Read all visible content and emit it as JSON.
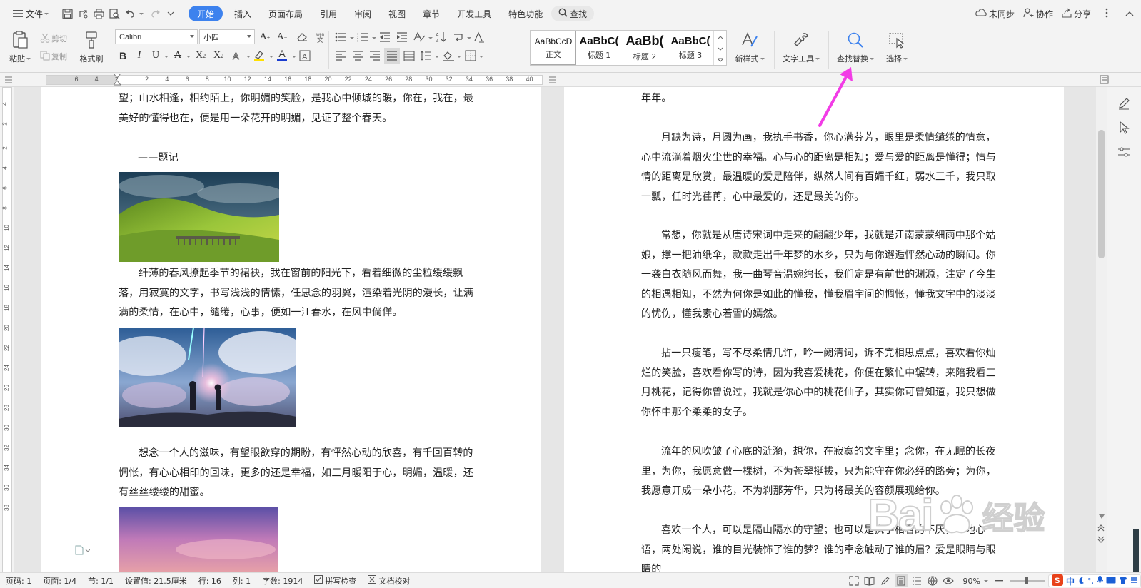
{
  "menubar": {
    "file_label": "文件",
    "tabs": [
      {
        "label": "开始",
        "active": true
      },
      {
        "label": "插入"
      },
      {
        "label": "页面布局"
      },
      {
        "label": "引用"
      },
      {
        "label": "审阅"
      },
      {
        "label": "视图"
      },
      {
        "label": "章节"
      },
      {
        "label": "开发工具"
      },
      {
        "label": "特色功能"
      }
    ],
    "search_label": "查找",
    "sync_label": "未同步",
    "collab_label": "协作",
    "share_label": "分享"
  },
  "ribbon": {
    "paste_label": "粘贴",
    "cut_label": "剪切",
    "copy_label": "复制",
    "format_painter_label": "格式刷",
    "font_name": "Calibri",
    "font_size": "小四",
    "styles": [
      {
        "sample": "AaBbCcD",
        "label": "正文"
      },
      {
        "sample": "AaBbC(",
        "label": "标题 1"
      },
      {
        "sample": "AaBb(",
        "label": "标题 2"
      },
      {
        "sample": "AaBbC(",
        "label": "标题 3"
      }
    ],
    "new_style_label": "新样式",
    "text_tools_label": "文字工具",
    "find_replace_label": "查找替换",
    "select_label": "选择"
  },
  "ruler": {
    "numbers": [
      "6",
      "4",
      "2",
      "2",
      "4",
      "6",
      "8",
      "10",
      "12",
      "14",
      "16",
      "18",
      "20",
      "22",
      "24",
      "26",
      "28",
      "30",
      "32",
      "34",
      "36",
      "38",
      "40"
    ]
  },
  "vruler": {
    "numbers": [
      "4",
      "2",
      "2",
      "4",
      "6",
      "8",
      "10",
      "12",
      "14",
      "16",
      "18",
      "20",
      "22",
      "24",
      "26",
      "28",
      "30",
      "32",
      "34",
      "36",
      "38"
    ]
  },
  "doc": {
    "left": {
      "p1": "望；山水相逢，相约陌上，你明媚的笑脸，是我心中倾城的暖，你在，我在，最美好的懂得也在，便是用一朵花开的明媚，见证了整个春天。",
      "signature": "——题记",
      "p2": "纤薄的春风撩起季节的裙袂，我在窗前的阳光下，看着细微的尘粒缓缓飘落，用寂寞的文字，书写浅浅的情愫，任思念的羽翼，渲染着光阴的漫长，让满满的柔情，在心中，缱绻，心事，便如一江春水，在风中倘佯。",
      "p3": "想念一个人的滋味，有望眼欲穿的期盼，有怦然心动的欣喜，有千回百转的惆怅，有心心相印的回味，更多的还是幸福，如三月暖阳于心，明媚，温暖，还有丝丝缕缕的甜蜜。"
    },
    "right": {
      "p0": "年年。",
      "p1": "月缺为诗，月圆为画，我执手书香，你心满芬芳，眼里是柔情缱绻的情意，心中流淌着烟火尘世的幸福。心与心的距离是相知；爱与爱的距离是懂得；情与情的距离是欣赏，最温暖的爱是陪伴，纵然人间有百媚千红，弱水三千，我只取一瓢，任时光荏苒，心中最爱的，还是最美的你。",
      "p2": "常想，你就是从唐诗宋词中走来的翩翩少年，我就是江南蒙蒙细雨中那个姑娘，撑一把油纸伞，款款走出千年梦的水乡，只为与你邂逅怦然心动的瞬间。你一袭白衣随风而舞，我一曲琴音温婉绵长，我们定是有前世的渊源，注定了今生的相遇相知，不然为何你是如此的懂我，懂我眉宇间的惆怅，懂我文字中的淡淡的忧伤，懂我素心若雪的嫣然。",
      "p3": "拈一只瘦笔，写不尽柔情几许，吟一阙清词，诉不完相思点点，喜欢看你灿烂的笑脸，喜欢看你写的诗，因为我喜爱桃花，你便在繁忙中辗转，来陪我看三月桃花，记得你曾说过，我就是你心中的桃花仙子，其实你可曾知道，我只想做你怀中那个柔柔的女子。",
      "p4": "流年的风吹皱了心底的涟漪，想你，在寂寞的文字里；念你，在无眠的长夜里，为你，我愿意做一棵树，不为苍翠挺拔，只为能守在你必经的路旁；为你，我愿意开成一朵小花，不为刹那芳华，只为将最美的容颜展现给你。",
      "p5": "喜欢一个人，可以是隔山隔水的守望；也可以是执手相看的不厌，一地心语，两处闲说，谁的目光装饰了谁的梦？谁的牵念触动了谁的眉？爱是眼睛与眼睛的"
    }
  },
  "statusbar": {
    "page_code": "页码: 1",
    "page": "页面: 1/4",
    "section": "节: 1/1",
    "setting": "设置值: 21.5厘米",
    "row": "行: 16",
    "col": "列: 1",
    "words": "字数: 1914",
    "spell_check": "拼写检查",
    "doc_proof": "文档校对",
    "zoom": "90%"
  },
  "watermark": {
    "text": "Bai",
    "jingyan": "经验"
  },
  "colors": {
    "accent": "#3d82ee",
    "arrow": "#f23ce6"
  }
}
